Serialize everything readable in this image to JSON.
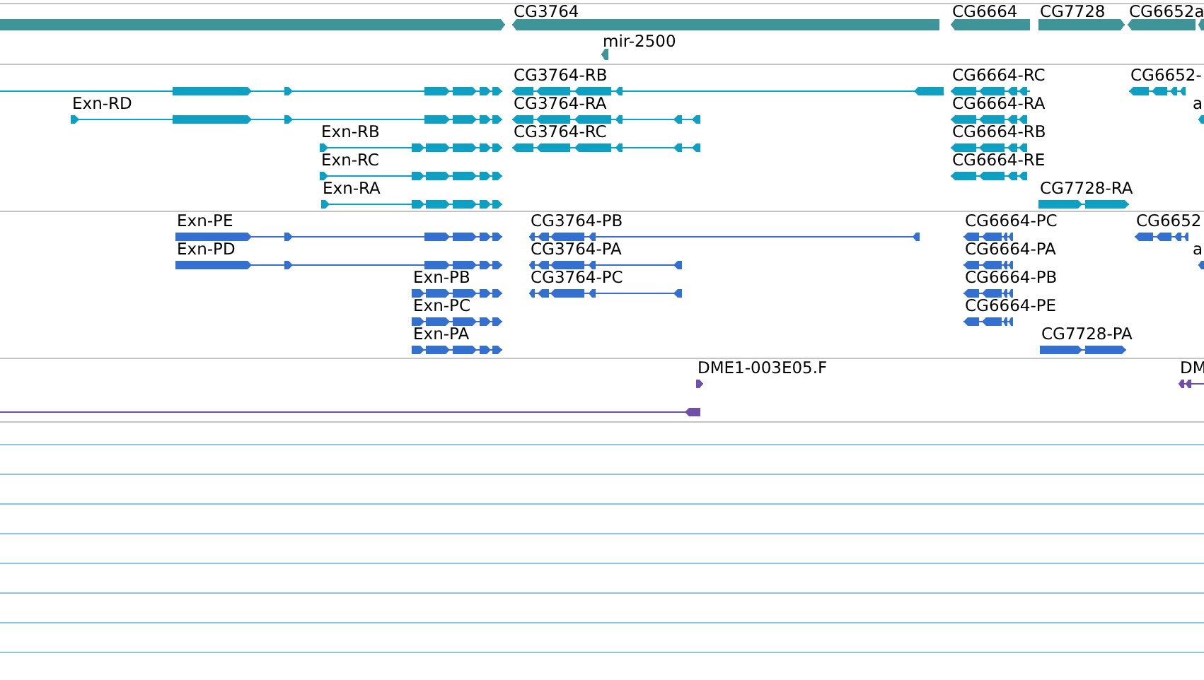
{
  "tracks": [
    {
      "kind": "gene",
      "features": [
        {
          "reverse": false
        },
        {
          "label": "CG3764",
          "reverse": true
        },
        {
          "label": "mir-2500",
          "reverse": true
        },
        {
          "label": "CG6664",
          "reverse": true
        },
        {
          "label": "CG7728",
          "reverse": false
        },
        {
          "label": "CG6652a",
          "reverse": true
        },
        {
          "reverse": true
        }
      ]
    },
    {
      "kind": "transcript",
      "features": [
        {
          "reverse": false
        },
        {
          "label": "CG3764-RB",
          "reverse": true
        },
        {
          "label": "CG6664-RC",
          "reverse": true
        },
        {
          "label": "CG6652-",
          "reverse": true
        },
        {
          "label": "Exn-RD",
          "reverse": false
        },
        {
          "label": "CG3764-RA",
          "reverse": true
        },
        {
          "label": "CG6664-RA",
          "reverse": true
        },
        {
          "label": "a",
          "reverse": true
        },
        {
          "label": "Exn-RB",
          "reverse": false
        },
        {
          "label": "CG3764-RC",
          "reverse": true
        },
        {
          "label": "CG6664-RB",
          "reverse": true
        },
        {
          "label": "Exn-RC",
          "reverse": false
        },
        {
          "label": "CG6664-RE",
          "reverse": true
        },
        {
          "label": "Exn-RA",
          "reverse": false
        },
        {
          "label": "CG7728-RA",
          "reverse": false
        }
      ]
    },
    {
      "kind": "protein",
      "features": [
        {
          "label": "Exn-PE",
          "reverse": false
        },
        {
          "label": "CG3764-PB",
          "reverse": true
        },
        {
          "label": "CG6664-PC",
          "reverse": true
        },
        {
          "label": "CG6652",
          "reverse": true
        },
        {
          "label": "Exn-PD",
          "reverse": false
        },
        {
          "label": "CG3764-PA",
          "reverse": true
        },
        {
          "label": "CG6664-PA",
          "reverse": true
        },
        {
          "label": "a",
          "reverse": true
        },
        {
          "label": "Exn-PB",
          "reverse": false
        },
        {
          "label": "CG3764-PC",
          "reverse": true
        },
        {
          "label": "CG6664-PB",
          "reverse": true
        },
        {
          "label": "Exn-PC",
          "reverse": false
        },
        {
          "label": "CG6664-PE",
          "reverse": true
        },
        {
          "label": "Exn-PA",
          "reverse": false
        },
        {
          "label": "CG7728-PA",
          "reverse": false
        }
      ]
    },
    {
      "kind": "clone",
      "features": [
        {
          "label": "DME1-003E05.F",
          "reverse": false
        },
        {
          "label": "DM",
          "reverse": true
        },
        {
          "reverse": true
        }
      ]
    }
  ]
}
